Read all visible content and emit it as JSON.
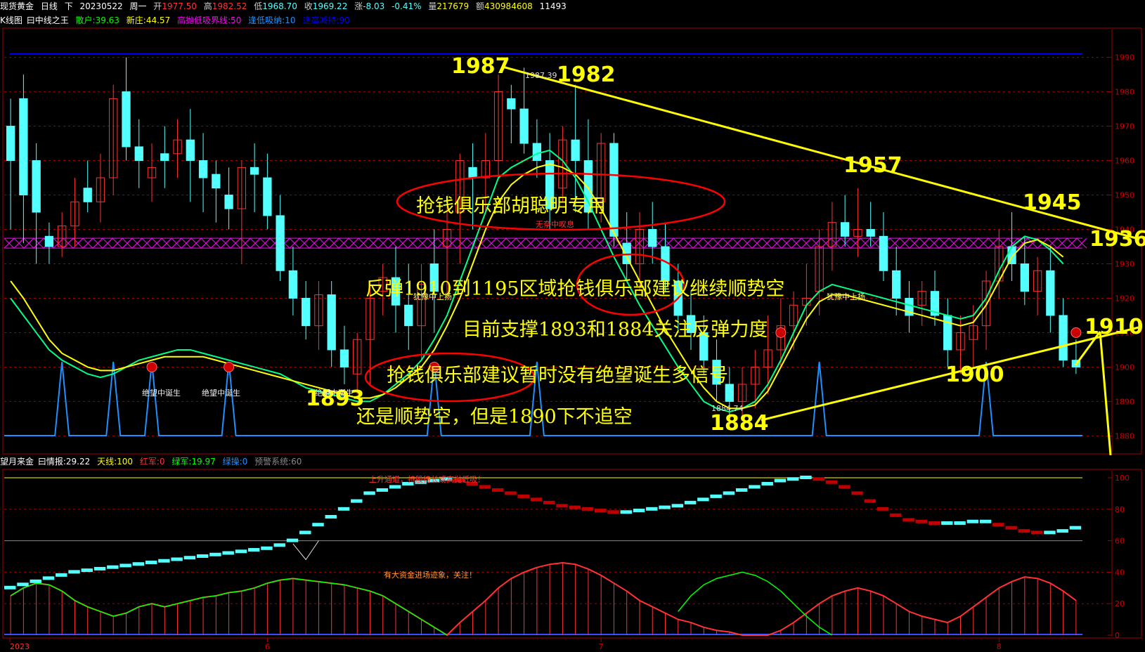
{
  "header": {
    "symbol": "现货黄金",
    "period": "日线",
    "direction": "下",
    "date": "20230522",
    "weekday": "周一",
    "open_label": "开",
    "open": "1977.50",
    "high_label": "高",
    "high": "1982.52",
    "low_label": "低",
    "low": "1968.70",
    "close_label": "收",
    "close": "1969.22",
    "change_label": "涨",
    "change": "-8.03",
    "change_pct": "-0.41%",
    "volume_label": "量",
    "volume": "217679",
    "amount_label": "额",
    "amount": "430984608",
    "extra": "11493"
  },
  "main_indicator": {
    "chart_name": "K线图",
    "indicator_name": "曰中线之王",
    "lines": [
      {
        "label": "散户:39.63",
        "color": "#00ff00"
      },
      {
        "label": "新庄:44.57",
        "color": "#ffff00"
      },
      {
        "label": "高抛低吸界线:50",
        "color": "#ff00ff"
      },
      {
        "label": "逢低吸纳:10",
        "color": "#1e90ff"
      },
      {
        "label": "逢高减持:90",
        "color": "#0000ff"
      }
    ]
  },
  "sub_indicator": {
    "name": "望月来金",
    "prefix": "曰情报:29.22",
    "lines": [
      {
        "label": "天线:100",
        "color": "#ffff00"
      },
      {
        "label": "红军:0",
        "color": "#ff3333"
      },
      {
        "label": "绿军:19.97",
        "color": "#00ff00"
      },
      {
        "label": "绿操:0",
        "color": "#1e90ff"
      },
      {
        "label": "预警系统:60",
        "color": "#888888"
      }
    ],
    "notes": [
      "上升通道，持股待长或高抛低吸！",
      "有大资金进场迹象，关注！"
    ]
  },
  "colors": {
    "up": "#ff3232",
    "down": "#54ffff",
    "grid": "#a00000",
    "annotation": "#ffff00",
    "ellipse": "#ff0000",
    "blue_line": "#0000ff"
  },
  "annotations": {
    "price_labels": [
      "1987",
      "1982",
      "1957",
      "1945",
      "1936",
      "1910",
      "1900",
      "1893",
      "1884"
    ],
    "small_labels": [
      "1987.39",
      "1884.74"
    ],
    "texts": [
      "抢钱俱乐部胡聪明专用",
      "反弹1910到1195区域抢钱俱乐部建议继续顺势空",
      "目前支撑1893和1884关注反弹力度",
      "抢钱俱乐部建议暂时没有绝望诞生多信号",
      "还是顺势空，但是1890下不追空"
    ],
    "signal_texts": [
      "无奈中叹息",
      "犹豫中上扬",
      "犹豫中上扬",
      "绝望中诞生",
      "绝望中诞生",
      "绝望中诞生"
    ]
  },
  "chart_data": [
    {
      "type": "candlestick",
      "title": "现货黄金 日线",
      "y_ticks": [
        1880,
        1890,
        1900,
        1910,
        1920,
        1930,
        1940,
        1950,
        1960,
        1970,
        1980,
        1990
      ],
      "ylim": [
        1876,
        1994
      ],
      "x_ticks": [
        "2023",
        "6",
        "7",
        "8",
        "9"
      ],
      "candles": [
        [
          1970,
          1978,
          1940,
          1960
        ],
        [
          1978,
          1985,
          1936,
          1950
        ],
        [
          1960,
          1965,
          1930,
          1945
        ],
        [
          1938,
          1942,
          1930,
          1935
        ],
        [
          1935,
          1945,
          1932,
          1941
        ],
        [
          1941,
          1955,
          1935,
          1948
        ],
        [
          1952,
          1960,
          1945,
          1948
        ],
        [
          1948,
          1962,
          1942,
          1955
        ],
        [
          1955,
          1982,
          1950,
          1978
        ],
        [
          1980,
          1990,
          1960,
          1964
        ],
        [
          1964,
          1972,
          1952,
          1960
        ],
        [
          1955,
          1965,
          1948,
          1958
        ],
        [
          1962,
          1970,
          1952,
          1960
        ],
        [
          1962,
          1972,
          1955,
          1966
        ],
        [
          1966,
          1975,
          1948,
          1960
        ],
        [
          1960,
          1968,
          1945,
          1955
        ],
        [
          1956,
          1960,
          1942,
          1952
        ],
        [
          1950,
          1958,
          1940,
          1946
        ],
        [
          1946,
          1960,
          1930,
          1958
        ],
        [
          1958,
          1965,
          1945,
          1956
        ],
        [
          1955,
          1962,
          1940,
          1944
        ],
        [
          1944,
          1950,
          1925,
          1928
        ],
        [
          1928,
          1935,
          1915,
          1920
        ],
        [
          1920,
          1925,
          1908,
          1912
        ],
        [
          1912,
          1925,
          1905,
          1921
        ],
        [
          1921,
          1925,
          1900,
          1905
        ],
        [
          1905,
          1912,
          1895,
          1900
        ],
        [
          1898,
          1910,
          1892,
          1908
        ],
        [
          1908,
          1925,
          1895,
          1920
        ],
        [
          1922,
          1930,
          1915,
          1926
        ],
        [
          1926,
          1935,
          1910,
          1918
        ],
        [
          1918,
          1930,
          1905,
          1912
        ],
        [
          1912,
          1930,
          1902,
          1924
        ],
        [
          1930,
          1940,
          1910,
          1922
        ],
        [
          1935,
          1948,
          1920,
          1940
        ],
        [
          1945,
          1962,
          1930,
          1960
        ],
        [
          1958,
          1965,
          1940,
          1955
        ],
        [
          1955,
          1968,
          1945,
          1960
        ],
        [
          1960,
          1985,
          1955,
          1980
        ],
        [
          1978,
          1982,
          1965,
          1975
        ],
        [
          1975,
          1987,
          1962,
          1965
        ],
        [
          1965,
          1972,
          1955,
          1960
        ],
        [
          1960,
          1968,
          1940,
          1946
        ],
        [
          1952,
          1970,
          1948,
          1966
        ],
        [
          1966,
          1982,
          1945,
          1960
        ],
        [
          1960,
          1972,
          1940,
          1945
        ],
        [
          1948,
          1968,
          1942,
          1965
        ],
        [
          1965,
          1968,
          1935,
          1938
        ],
        [
          1936,
          1945,
          1925,
          1930
        ],
        [
          1930,
          1945,
          1922,
          1940
        ],
        [
          1940,
          1948,
          1930,
          1935
        ],
        [
          1935,
          1942,
          1922,
          1925
        ],
        [
          1925,
          1930,
          1910,
          1915
        ],
        [
          1915,
          1922,
          1905,
          1910
        ],
        [
          1910,
          1915,
          1898,
          1902
        ],
        [
          1902,
          1908,
          1890,
          1895
        ],
        [
          1895,
          1900,
          1885,
          1890
        ],
        [
          1890,
          1900,
          1885,
          1895
        ],
        [
          1895,
          1905,
          1888,
          1900
        ],
        [
          1900,
          1915,
          1892,
          1905
        ],
        [
          1905,
          1920,
          1900,
          1912
        ],
        [
          1912,
          1922,
          1905,
          1918
        ],
        [
          1918,
          1930,
          1912,
          1920
        ],
        [
          1922,
          1940,
          1915,
          1935
        ],
        [
          1935,
          1948,
          1928,
          1942
        ],
        [
          1942,
          1950,
          1935,
          1938
        ],
        [
          1938,
          1952,
          1932,
          1940
        ],
        [
          1940,
          1948,
          1935,
          1938
        ],
        [
          1938,
          1945,
          1925,
          1928
        ],
        [
          1928,
          1935,
          1915,
          1920
        ],
        [
          1920,
          1925,
          1910,
          1915
        ],
        [
          1918,
          1925,
          1912,
          1922
        ],
        [
          1922,
          1928,
          1912,
          1915
        ],
        [
          1915,
          1920,
          1900,
          1905
        ],
        [
          1905,
          1915,
          1898,
          1910
        ],
        [
          1908,
          1918,
          1900,
          1912
        ],
        [
          1912,
          1928,
          1905,
          1925
        ],
        [
          1925,
          1940,
          1920,
          1935
        ],
        [
          1935,
          1945,
          1925,
          1930
        ],
        [
          1930,
          1938,
          1918,
          1922
        ],
        [
          1922,
          1932,
          1915,
          1928
        ],
        [
          1928,
          1935,
          1910,
          1915
        ],
        [
          1915,
          1920,
          1900,
          1902
        ],
        [
          1902,
          1908,
          1898,
          1900
        ]
      ],
      "lines": {
        "retail": [
          1920,
          1915,
          1910,
          1905,
          1902,
          1900,
          1898,
          1897,
          1898,
          1900,
          1902,
          1903,
          1904,
          1905,
          1905,
          1904,
          1903,
          1902,
          1901,
          1900,
          1899,
          1898,
          1896,
          1894,
          1893,
          1892,
          1891,
          1890,
          1890,
          1892,
          1895,
          1898,
          1902,
          1908,
          1915,
          1925,
          1935,
          1945,
          1955,
          1958,
          1960,
          1962,
          1963,
          1960,
          1955,
          1948,
          1940,
          1932,
          1925,
          1918,
          1912,
          1906,
          1900,
          1895,
          1890,
          1888,
          1887,
          1888,
          1890,
          1895,
          1902,
          1910,
          1918,
          1922,
          1924,
          1923,
          1922,
          1921,
          1920,
          1919,
          1918,
          1917,
          1916,
          1915,
          1914,
          1915,
          1920,
          1928,
          1935,
          1938,
          1937,
          1934,
          1930
        ],
        "new_dealer": [
          1925,
          1920,
          1914,
          1908,
          1904,
          1902,
          1900,
          1899,
          1899,
          1900,
          1901,
          1902,
          1903,
          1903,
          1903,
          1903,
          1902,
          1901,
          1900,
          1899,
          1898,
          1897,
          1896,
          1895,
          1894,
          1893,
          1892,
          1891,
          1891,
          1892,
          1894,
          1897,
          1900,
          1905,
          1912,
          1920,
          1930,
          1940,
          1948,
          1953,
          1956,
          1958,
          1959,
          1958,
          1956,
          1952,
          1946,
          1939,
          1932,
          1925,
          1918,
          1911,
          1905,
          1899,
          1894,
          1890,
          1888,
          1888,
          1889,
          1893,
          1900,
          1907,
          1914,
          1919,
          1921,
          1921,
          1920,
          1919,
          1918,
          1917,
          1916,
          1915,
          1914,
          1913,
          1912,
          1913,
          1918,
          1925,
          1932,
          1936,
          1937,
          1935,
          1932
        ]
      },
      "reference_line": 1936,
      "blue_line": 1991
    },
    {
      "type": "line",
      "title": "望月来金",
      "y_ticks": [
        0,
        20,
        40,
        60,
        80,
        100
      ],
      "ylim": [
        0,
        100
      ],
      "series": [
        {
          "name": "天线",
          "values": [
            100
          ]
        },
        {
          "name": "预警系统",
          "values": [
            60
          ]
        }
      ],
      "staircase": [
        30,
        32,
        34,
        36,
        38,
        40,
        41,
        42,
        43,
        44,
        45,
        46,
        47,
        48,
        49,
        50,
        51,
        52,
        53,
        54,
        55,
        57,
        60,
        65,
        70,
        75,
        80,
        85,
        90,
        92,
        94,
        96,
        97,
        98,
        99,
        98,
        96,
        94,
        92,
        90,
        88,
        86,
        84,
        82,
        81,
        80,
        79,
        78,
        78,
        79,
        80,
        81,
        82,
        84,
        86,
        88,
        90,
        92,
        94,
        96,
        98,
        99,
        100,
        99,
        97,
        94,
        90,
        85,
        80,
        76,
        73,
        72,
        71,
        71,
        71,
        72,
        72,
        70,
        68,
        66,
        65,
        65,
        66,
        68,
        70
      ],
      "red_bars": [
        25,
        30,
        33,
        32,
        28,
        22,
        18,
        15,
        12,
        14,
        18,
        20,
        18,
        20,
        22,
        24,
        25,
        27,
        28,
        30,
        33,
        35,
        36,
        35,
        34,
        33,
        32,
        30,
        28,
        25,
        20,
        15,
        10,
        5,
        0,
        8,
        15,
        22,
        30,
        36,
        40,
        43,
        45,
        46,
        45,
        42,
        38,
        33,
        28,
        22,
        18,
        14,
        10,
        8,
        5,
        3,
        2,
        0,
        0,
        0,
        3,
        8,
        14,
        20,
        25,
        28,
        30,
        28,
        25,
        20,
        15,
        12,
        10,
        8,
        12,
        18,
        24,
        30,
        34,
        37,
        36,
        33,
        28,
        22,
        16
      ],
      "green_line": [
        25,
        30,
        33,
        32,
        28,
        22,
        18,
        15,
        12,
        14,
        18,
        20,
        18,
        20,
        22,
        24,
        25,
        27,
        28,
        30,
        33,
        35,
        36,
        35,
        34,
        33,
        32,
        30,
        28,
        25,
        20,
        15,
        10,
        5,
        0,
        null,
        null,
        null,
        null,
        null,
        null,
        null,
        null,
        null,
        null,
        null,
        null,
        null,
        null,
        null,
        null,
        null,
        15,
        25,
        32,
        36,
        38,
        40,
        38,
        34,
        28,
        20,
        12,
        5,
        0,
        null,
        null,
        null,
        null,
        null,
        null,
        null,
        null,
        null,
        null,
        null,
        null,
        null,
        null,
        null,
        null,
        null,
        null,
        null,
        null
      ]
    }
  ]
}
